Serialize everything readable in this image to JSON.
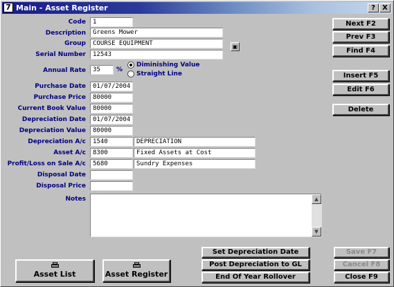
{
  "window": {
    "title": "Main - Asset Register",
    "icon_glyph": "7",
    "help_glyph": "?",
    "close_glyph": "X"
  },
  "labels": {
    "code": "Code",
    "description": "Description",
    "group": "Group",
    "serial_number": "Serial Number",
    "annual_rate": "Annual Rate",
    "percent": "%",
    "purchase_date": "Purchase Date",
    "purchase_price": "Purchase Price",
    "current_book_value": "Current Book Value",
    "depreciation_date": "Depreciation Date",
    "depreciation_value": "Depreciation Value",
    "depreciation_ac": "Depreciation A/c",
    "asset_ac": "Asset A/c",
    "profit_loss_ac": "Profit/Loss on Sale A/c",
    "disposal_date": "Disposal Date",
    "disposal_price": "Disposal Price",
    "notes": "Notes"
  },
  "fields": {
    "code": "1",
    "description": "Greens Mower",
    "group": "COURSE EQUIPMENT",
    "serial_number": "12543",
    "annual_rate": "35",
    "purchase_date": "01/07/2004",
    "purchase_price": "80000",
    "current_book_value": "80000",
    "depreciation_date": "01/07/2004",
    "depreciation_value": "80000",
    "depreciation_ac": "1540",
    "depreciation_ac_name": "DEPRECIATION",
    "asset_ac": "8300",
    "asset_ac_name": "Fixed Assets at Cost",
    "profit_loss_ac": "5680",
    "profit_loss_ac_name": "Sundry Expenses",
    "disposal_date": "",
    "disposal_price": "",
    "notes": ""
  },
  "rate_method": {
    "options": [
      "Diminishing Value",
      "Straight Line"
    ],
    "selected": "Diminishing Value"
  },
  "side_buttons": {
    "next": "Next F2",
    "prev": "Prev F3",
    "find": "Find F4",
    "insert": "Insert F5",
    "edit": "Edit F6",
    "delete": "Delete"
  },
  "bottom_buttons": {
    "asset_list": "Asset List",
    "asset_register": "Asset Register",
    "set_depreciation_date": "Set Depreciation Date",
    "post_depreciation": "Post Depreciation to GL",
    "end_of_year": "End Of Year Rollover",
    "save": "Save F7",
    "cancel": "Cancel F8",
    "close": "Close F9"
  },
  "icons": {
    "lookup": "lookup-icon",
    "printer": "printer-icon"
  },
  "colors": {
    "label_text": "#000080",
    "title_gradient_start": "#1a1a8a",
    "disabled_text": "#8a8a8a"
  }
}
